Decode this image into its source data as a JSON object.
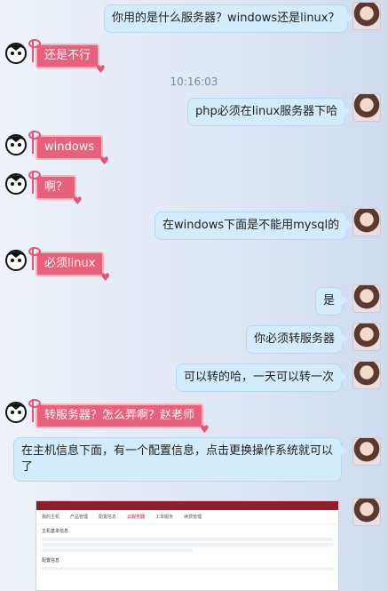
{
  "messages": [
    {
      "side": "me",
      "text": "你用的是什么服务器？windows还是linux？"
    },
    {
      "side": "other",
      "text": "还是不行"
    },
    {
      "side": "me",
      "text": "php必须在linux服务器下哈"
    },
    {
      "side": "other",
      "text": "windows"
    },
    {
      "side": "other",
      "text": "啊？"
    },
    {
      "side": "me",
      "text": "在windows下面是不能用mysql的"
    },
    {
      "side": "other",
      "text": "必须linux"
    },
    {
      "side": "me",
      "text": "是"
    },
    {
      "side": "me",
      "text": "你必须转服务器"
    },
    {
      "side": "me",
      "text": "可以转的哈，一天可以转一次"
    },
    {
      "side": "other",
      "text": "转服务器？怎么弄啊？赵老师"
    },
    {
      "side": "me",
      "text": "在主机信息下面，有一个配置信息，点击更换操作系统就可以了"
    }
  ],
  "timestamp": "10:16:03",
  "screenshot": {
    "title": "我的主机",
    "tabs": [
      "产品管理",
      "配置信息",
      "云服务器",
      "工单服务",
      "续费管理"
    ],
    "section1": "主机基本信息",
    "section2": "配置信息"
  },
  "colors": {
    "bubble": "#d2ecfb",
    "pink": "#e9607a"
  }
}
